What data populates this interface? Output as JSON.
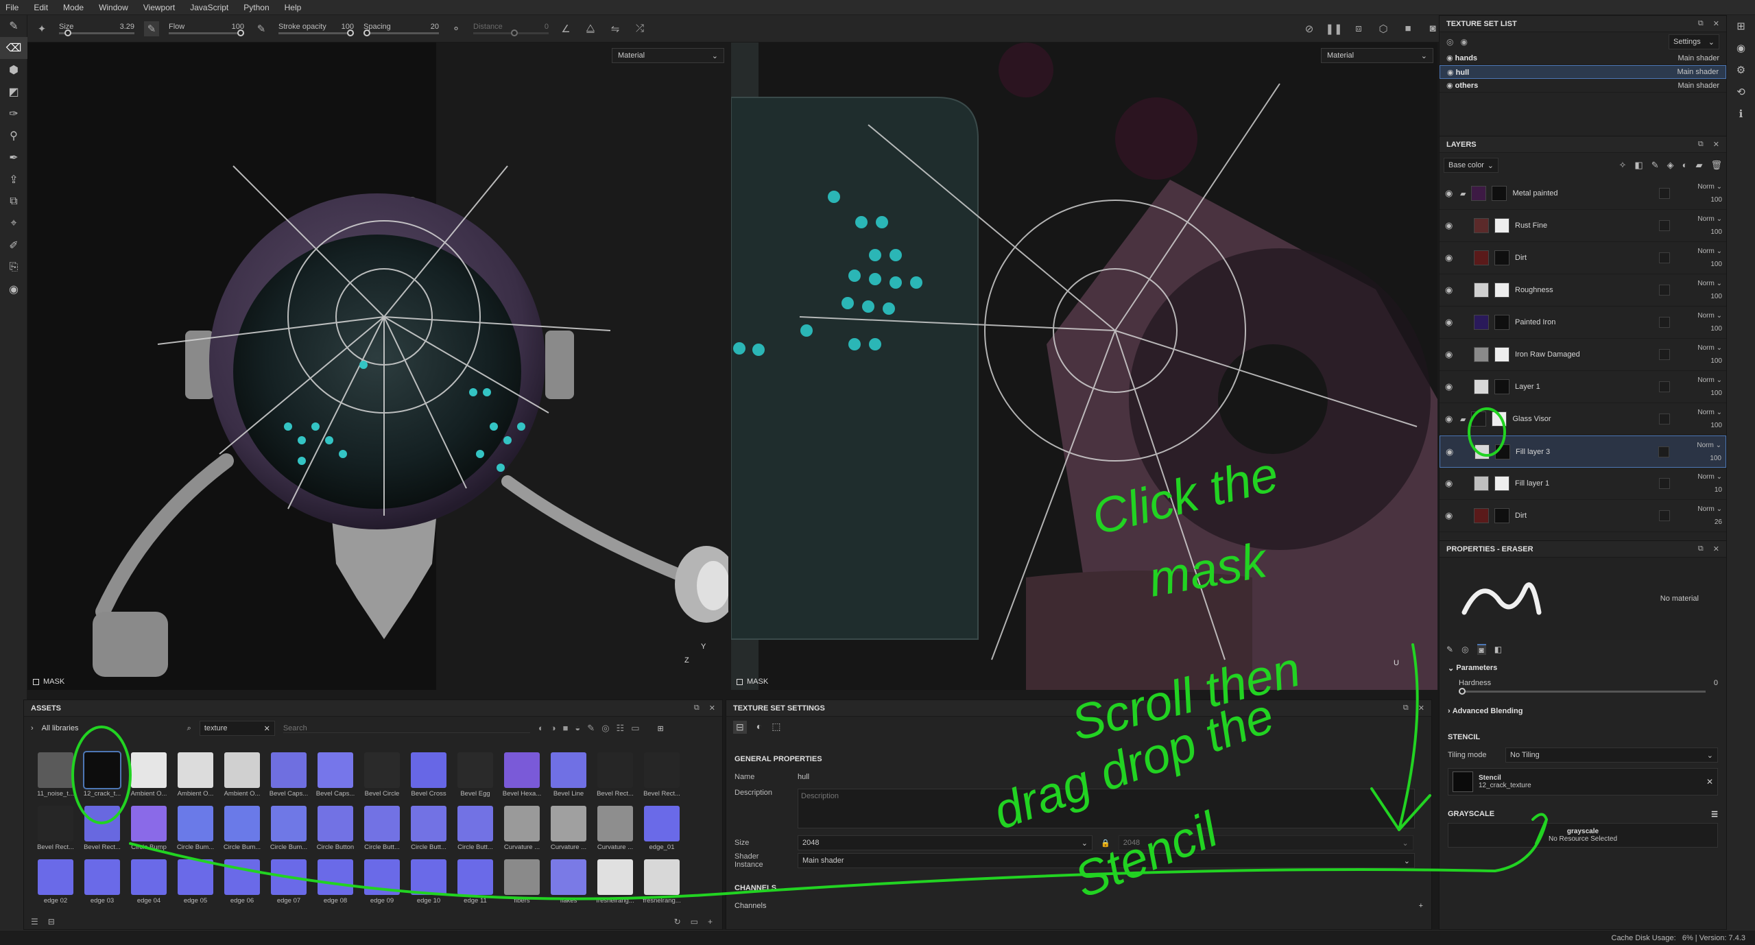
{
  "menu": [
    "File",
    "Edit",
    "Mode",
    "Window",
    "Viewport",
    "JavaScript",
    "Python",
    "Help"
  ],
  "toolbar": {
    "size_label": "Size",
    "size_value": "3.29",
    "flow_label": "Flow",
    "flow_value": "100",
    "stroke_label": "Stroke opacity",
    "stroke_value": "100",
    "spacing_label": "Spacing",
    "spacing_value": "20",
    "distance_label": "Distance",
    "distance_value": "0"
  },
  "viewport_left": {
    "material_select": "Material",
    "mask_label": "MASK",
    "axis_y": "Y",
    "axis_z": "Z"
  },
  "viewport_right": {
    "material_select": "Material",
    "mask_label": "MASK",
    "axis_u": "U"
  },
  "texture_set_list": {
    "title": "TEXTURE SET LIST",
    "settings_label": "Settings",
    "items": [
      {
        "name": "hands",
        "shader": "Main shader"
      },
      {
        "name": "hull",
        "shader": "Main shader"
      },
      {
        "name": "others",
        "shader": "Main shader"
      }
    ]
  },
  "layers": {
    "title": "LAYERS",
    "channel_select": "Base color",
    "items": [
      {
        "name": "Metal painted",
        "blend": "Norm",
        "opacity": "100"
      },
      {
        "name": "Rust Fine",
        "blend": "Norm",
        "opacity": "100"
      },
      {
        "name": "Dirt",
        "blend": "Norm",
        "opacity": "100"
      },
      {
        "name": "Roughness",
        "blend": "Norm",
        "opacity": "100"
      },
      {
        "name": "Painted Iron",
        "blend": "Norm",
        "opacity": "100"
      },
      {
        "name": "Iron Raw Damaged",
        "blend": "Norm",
        "opacity": "100"
      },
      {
        "name": "Layer 1",
        "blend": "Norm",
        "opacity": "100"
      },
      {
        "name": "Glass Visor",
        "blend": "Norm",
        "opacity": "100"
      },
      {
        "name": "Fill layer 3",
        "blend": "Norm",
        "opacity": "100"
      },
      {
        "name": "Fill layer 1",
        "blend": "Norm",
        "opacity": "10"
      },
      {
        "name": "Dirt",
        "blend": "Norm",
        "opacity": "26"
      }
    ]
  },
  "properties": {
    "title": "PROPERTIES - ERASER",
    "no_material": "No material",
    "parameters_label": "Parameters",
    "hardness_label": "Hardness",
    "hardness_value": "0",
    "advanced_label": "Advanced Blending",
    "stencil_section": "STENCIL",
    "tiling_label": "Tiling mode",
    "tiling_value": "No Tiling",
    "stencil_label": "Stencil",
    "stencil_value": "12_crack_texture",
    "grayscale_section": "GRAYSCALE",
    "grayscale_label": "grayscale",
    "grayscale_value": "No Resource Selected"
  },
  "assets": {
    "title": "ASSETS",
    "libraries_label": "All libraries",
    "filter_tag": "texture",
    "search_placeholder": "Search",
    "items": [
      {
        "label": "11_noise_t...",
        "color": "#5a5a5a"
      },
      {
        "label": "12_crack_t...",
        "color": "#0d0d0d"
      },
      {
        "label": "Ambient O...",
        "color": "#e6e6e6"
      },
      {
        "label": "Ambient O...",
        "color": "#dcdcdc"
      },
      {
        "label": "Ambient O...",
        "color": "#d0d0d0"
      },
      {
        "label": "Bevel Caps...",
        "color": "#6f6fe0"
      },
      {
        "label": "Bevel Caps...",
        "color": "#7676ea"
      },
      {
        "label": "Bevel Circle",
        "color": "#2a2a2a"
      },
      {
        "label": "Bevel Cross",
        "color": "#6767e6"
      },
      {
        "label": "Bevel Egg",
        "color": "#2a2a2a"
      },
      {
        "label": "Bevel Hexa...",
        "color": "#7a5ad8"
      },
      {
        "label": "Bevel Line",
        "color": "#7070e4"
      },
      {
        "label": "Bevel Rect...",
        "color": "#262626"
      },
      {
        "label": "Bevel Rect...",
        "color": "#262626"
      },
      {
        "label": "Bevel Rect...",
        "color": "#262626"
      },
      {
        "label": "Bevel Rect...",
        "color": "#6868e0"
      },
      {
        "label": "Circle Bump",
        "color": "#8a6ae8"
      },
      {
        "label": "Circle Bum...",
        "color": "#6a7ae8"
      },
      {
        "label": "Circle Bum...",
        "color": "#6a7ae8"
      },
      {
        "label": "Circle Bum...",
        "color": "#6f78e6"
      },
      {
        "label": "Circle Button",
        "color": "#7272e4"
      },
      {
        "label": "Circle Butt...",
        "color": "#7272e4"
      },
      {
        "label": "Circle Butt...",
        "color": "#7272e4"
      },
      {
        "label": "Circle Butt...",
        "color": "#7272e4"
      },
      {
        "label": "Curvature ...",
        "color": "#9a9a9a"
      },
      {
        "label": "Curvature ...",
        "color": "#a0a0a0"
      },
      {
        "label": "Curvature ...",
        "color": "#8e8e8e"
      },
      {
        "label": "edge_01",
        "color": "#6a6ae8"
      },
      {
        "label": "edge 02",
        "color": "#6a6ae8"
      },
      {
        "label": "edge 03",
        "color": "#6a6ae8"
      },
      {
        "label": "edge 04",
        "color": "#6a6ae8"
      },
      {
        "label": "edge 05",
        "color": "#6a6ae8"
      },
      {
        "label": "edge 06",
        "color": "#6a6ae8"
      },
      {
        "label": "edge 07",
        "color": "#6a6ae8"
      },
      {
        "label": "edge 08",
        "color": "#6a6ae8"
      },
      {
        "label": "edge 09",
        "color": "#6a6ae8"
      },
      {
        "label": "edge 10",
        "color": "#6a6ae8"
      },
      {
        "label": "edge 11",
        "color": "#6a6ae8"
      },
      {
        "label": "fibers",
        "color": "#8a8a8a"
      },
      {
        "label": "flakes",
        "color": "#7a7ae6"
      },
      {
        "label": "fresnelrang...",
        "color": "#e0e0e0"
      },
      {
        "label": "fresnelrang...",
        "color": "#d8d8d8"
      }
    ]
  },
  "texture_set_settings": {
    "title": "TEXTURE SET SETTINGS",
    "general_label": "GENERAL PROPERTIES",
    "name_label": "Name",
    "name_value": "hull",
    "desc_label": "Description",
    "desc_placeholder": "Description",
    "size_label": "Size",
    "size_value": "2048",
    "size_value2": "2048",
    "shader_label": "Shader Instance",
    "shader_value": "Main shader",
    "channels_section": "CHANNELS",
    "channels_label": "Channels"
  },
  "annotations": {
    "line1": "Click the",
    "line2": "mask",
    "line3": "Scroll then",
    "line4": "drag drop the",
    "line5": "Stencil",
    "color": "#22d322"
  },
  "status": {
    "cache": "Cache Disk Usage:",
    "cache_value": "6%",
    "version": "Version: 7.4.3"
  }
}
